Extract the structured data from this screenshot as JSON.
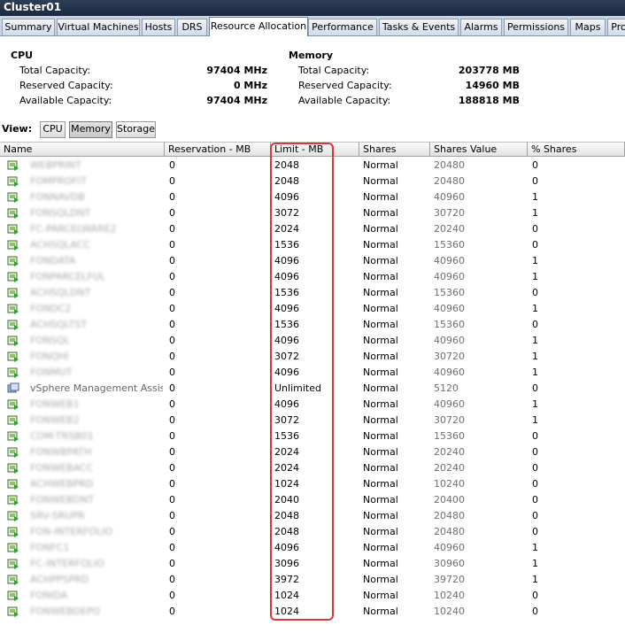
{
  "window": {
    "title": "Cluster01"
  },
  "tabs": [
    "Summary",
    "Virtual Machines",
    "Hosts",
    "DRS",
    "Resource Allocation",
    "Performance",
    "Tasks & Events",
    "Alarms",
    "Permissions",
    "Maps",
    "Pro"
  ],
  "active_tab": "Resource Allocation",
  "cpu": {
    "heading": "CPU",
    "total_label": "Total Capacity:",
    "total_value": "97404 MHz",
    "reserved_label": "Reserved Capacity:",
    "reserved_value": "0 MHz",
    "available_label": "Available Capacity:",
    "available_value": "97404 MHz"
  },
  "memory": {
    "heading": "Memory",
    "total_label": "Total Capacity:",
    "total_value": "203778 MB",
    "reserved_label": "Reserved Capacity:",
    "reserved_value": "14960 MB",
    "available_label": "Available Capacity:",
    "available_value": "188818 MB"
  },
  "view": {
    "label": "View:",
    "buttons": [
      "CPU",
      "Memory",
      "Storage"
    ],
    "selected": "Memory"
  },
  "columns": [
    "Name",
    "Reservation - MB",
    "Limit - MB",
    "Shares",
    "Shares Value",
    "% Shares"
  ],
  "rows": [
    {
      "name": "WEBPRINT",
      "icon": "vm-icon",
      "reservation": "0",
      "limit": "2048",
      "shares": "Normal",
      "shares_value": "20480",
      "pct": "0"
    },
    {
      "name": "FOMPROFIT",
      "icon": "vm-icon",
      "reservation": "0",
      "limit": "2048",
      "shares": "Normal",
      "shares_value": "20480",
      "pct": "0"
    },
    {
      "name": "FONNAVDB",
      "icon": "vm-icon",
      "reservation": "0",
      "limit": "4096",
      "shares": "Normal",
      "shares_value": "40960",
      "pct": "1"
    },
    {
      "name": "FONSQLDNT",
      "icon": "vm-icon",
      "reservation": "0",
      "limit": "3072",
      "shares": "Normal",
      "shares_value": "30720",
      "pct": "1"
    },
    {
      "name": "FC-PARCELWARE2",
      "icon": "vm-icon",
      "reservation": "0",
      "limit": "2024",
      "shares": "Normal",
      "shares_value": "20240",
      "pct": "0"
    },
    {
      "name": "ACHSQLACC",
      "icon": "vm-icon",
      "reservation": "0",
      "limit": "1536",
      "shares": "Normal",
      "shares_value": "15360",
      "pct": "0"
    },
    {
      "name": "FONDATA",
      "icon": "vm-icon",
      "reservation": "0",
      "limit": "4096",
      "shares": "Normal",
      "shares_value": "40960",
      "pct": "1"
    },
    {
      "name": "FONPARCELFUL",
      "icon": "vm-icon",
      "reservation": "0",
      "limit": "4096",
      "shares": "Normal",
      "shares_value": "40960",
      "pct": "1"
    },
    {
      "name": "ACHSQLDNT",
      "icon": "vm-icon",
      "reservation": "0",
      "limit": "1536",
      "shares": "Normal",
      "shares_value": "15360",
      "pct": "0"
    },
    {
      "name": "FONDC2",
      "icon": "vm-icon",
      "reservation": "0",
      "limit": "4096",
      "shares": "Normal",
      "shares_value": "40960",
      "pct": "1"
    },
    {
      "name": "ACHSQLTST",
      "icon": "vm-icon",
      "reservation": "0",
      "limit": "1536",
      "shares": "Normal",
      "shares_value": "15360",
      "pct": "0"
    },
    {
      "name": "FONSQL",
      "icon": "vm-icon",
      "reservation": "0",
      "limit": "4096",
      "shares": "Normal",
      "shares_value": "40960",
      "pct": "1"
    },
    {
      "name": "FONQHI",
      "icon": "vm-icon",
      "reservation": "0",
      "limit": "3072",
      "shares": "Normal",
      "shares_value": "30720",
      "pct": "1"
    },
    {
      "name": "FONMUT",
      "icon": "vm-icon",
      "reservation": "0",
      "limit": "4096",
      "shares": "Normal",
      "shares_value": "40960",
      "pct": "1"
    },
    {
      "name": "vSphere Management Assis...",
      "icon": "appliance-icon",
      "reservation": "0",
      "limit": "Unlimited",
      "shares": "Normal",
      "shares_value": "5120",
      "pct": "0",
      "sharp": true
    },
    {
      "name": "FONWEB1",
      "icon": "vm-icon",
      "reservation": "0",
      "limit": "4096",
      "shares": "Normal",
      "shares_value": "40960",
      "pct": "1"
    },
    {
      "name": "FONWEB2",
      "icon": "vm-icon",
      "reservation": "0",
      "limit": "3072",
      "shares": "Normal",
      "shares_value": "30720",
      "pct": "1"
    },
    {
      "name": "COM-TRSB01",
      "icon": "vm-icon",
      "reservation": "0",
      "limit": "1536",
      "shares": "Normal",
      "shares_value": "15360",
      "pct": "0"
    },
    {
      "name": "FONWBPATH",
      "icon": "vm-icon",
      "reservation": "0",
      "limit": "2024",
      "shares": "Normal",
      "shares_value": "20240",
      "pct": "0"
    },
    {
      "name": "FONWEBACC",
      "icon": "vm-icon",
      "reservation": "0",
      "limit": "2024",
      "shares": "Normal",
      "shares_value": "20240",
      "pct": "0"
    },
    {
      "name": "ACHWEBPRD",
      "icon": "vm-icon",
      "reservation": "0",
      "limit": "1024",
      "shares": "Normal",
      "shares_value": "10240",
      "pct": "0"
    },
    {
      "name": "FONWEBDNT",
      "icon": "vm-icon",
      "reservation": "0",
      "limit": "2040",
      "shares": "Normal",
      "shares_value": "20400",
      "pct": "0"
    },
    {
      "name": "SRV-SRUPR",
      "icon": "vm-icon",
      "reservation": "0",
      "limit": "2048",
      "shares": "Normal",
      "shares_value": "20480",
      "pct": "0"
    },
    {
      "name": "FON-INTERFOLIO",
      "icon": "vm-icon",
      "reservation": "0",
      "limit": "2048",
      "shares": "Normal",
      "shares_value": "20480",
      "pct": "0"
    },
    {
      "name": "FONFC1",
      "icon": "vm-icon",
      "reservation": "0",
      "limit": "4096",
      "shares": "Normal",
      "shares_value": "40960",
      "pct": "1"
    },
    {
      "name": "FC-INTERFOLIO",
      "icon": "vm-icon",
      "reservation": "0",
      "limit": "3096",
      "shares": "Normal",
      "shares_value": "30960",
      "pct": "1"
    },
    {
      "name": "ACHPPSPRD",
      "icon": "vm-icon",
      "reservation": "0",
      "limit": "3972",
      "shares": "Normal",
      "shares_value": "39720",
      "pct": "1"
    },
    {
      "name": "FONIDA",
      "icon": "vm-icon",
      "reservation": "0",
      "limit": "1024",
      "shares": "Normal",
      "shares_value": "10240",
      "pct": "0"
    },
    {
      "name": "FONWEBDEPO",
      "icon": "vm-icon",
      "reservation": "0",
      "limit": "1024",
      "shares": "Normal",
      "shares_value": "10240",
      "pct": "0"
    }
  ]
}
